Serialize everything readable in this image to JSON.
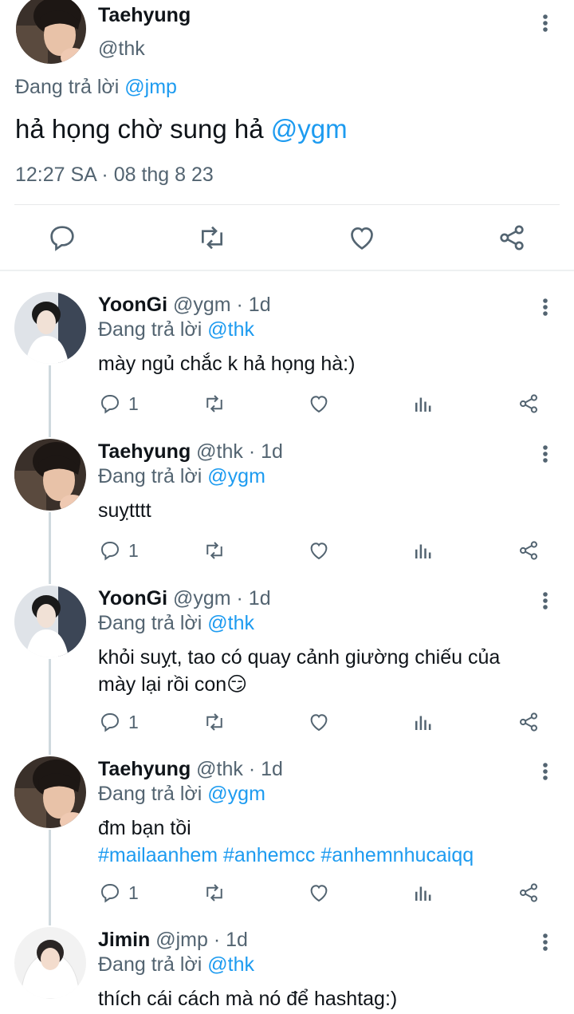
{
  "main_tweet": {
    "name": "Taehyung",
    "handle": "@thk",
    "reply_prefix": "Đang trả lời ",
    "reply_to": "@jmp",
    "text": "hả họng chờ sung hả ",
    "mention": "@ygm",
    "timestamp": "12:27 SA · 08 thg 8 23",
    "actions": [
      "reply-icon",
      "retweet-icon",
      "like-icon",
      "share-icon"
    ]
  },
  "replies": [
    {
      "name": "YoonGi",
      "handle": "@ygm",
      "time": " · 1d",
      "reply_prefix": "Đang trả lời ",
      "reply_to": "@thk",
      "line1": "mày ngủ chắc k hả họng hà:)",
      "reply_count": "1"
    },
    {
      "name": "Taehyung",
      "handle": "@thk",
      "time": " · 1d",
      "reply_prefix": "Đang trả lời ",
      "reply_to": "@ygm",
      "line1": "suỵtttt",
      "reply_count": "1"
    },
    {
      "name": "YoonGi",
      "handle": "@ygm",
      "time": " · 1d",
      "reply_prefix": "Đang trả lời ",
      "reply_to": "@thk",
      "line1": "khỏi suỵt, tao có quay cảnh giường chiếu của",
      "line2": "mày lại rồi con😏",
      "reply_count": "1"
    },
    {
      "name": "Taehyung",
      "handle": "@thk",
      "time": " · 1d",
      "reply_prefix": "Đang trả lời ",
      "reply_to": "@ygm",
      "line1": "đm bạn tồi",
      "hashtags": "#mailaanhem #anhemcc #anhemnhucaiqq",
      "reply_count": "1"
    },
    {
      "name": "Jimin",
      "handle": "@jmp",
      "time": " · 1d",
      "reply_prefix": "Đang trả lời ",
      "reply_to": "@thk",
      "line1": "thích cái cách mà nó để hashtag:)"
    }
  ],
  "reply_actions": [
    "reply-icon",
    "retweet-icon",
    "like-icon",
    "views-icon",
    "share-icon"
  ],
  "colors": {
    "link": "#1d9bf0",
    "muted": "#536471",
    "text": "#0f1419"
  }
}
